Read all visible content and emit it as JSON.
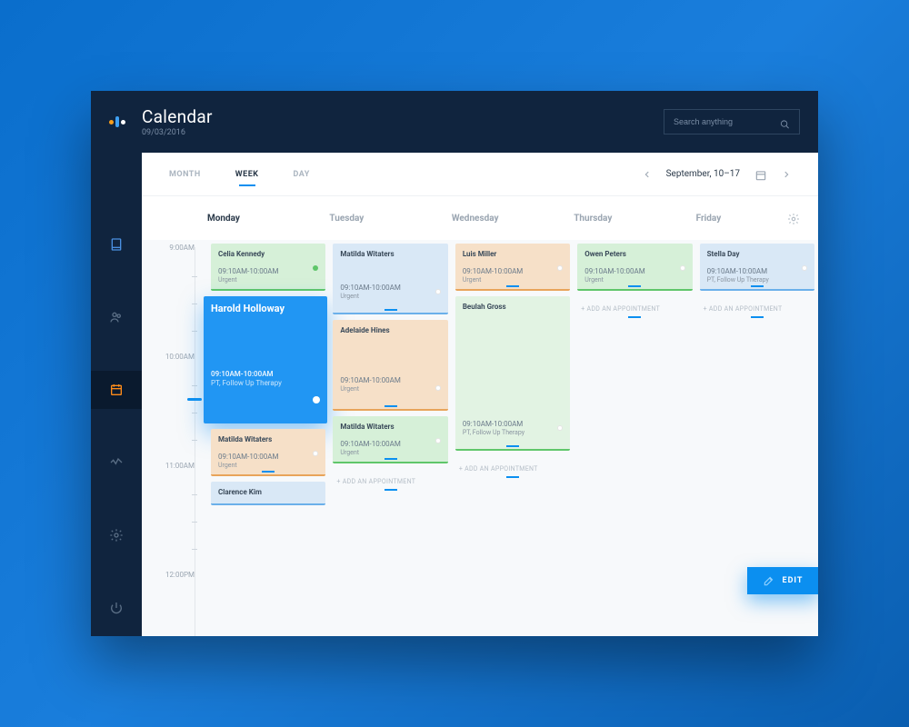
{
  "header": {
    "title": "Calendar",
    "date": "09/03/2016",
    "search_placeholder": "Search anything"
  },
  "toolbar": {
    "tabs": {
      "month": "MONTH",
      "week": "WEEK",
      "day": "DAY"
    },
    "date_range": "September, 10–17"
  },
  "days": [
    "Monday",
    "Tuesday",
    "Wednesday",
    "Thursday",
    "Friday"
  ],
  "times": {
    "t9": "9:00AM",
    "t10": "10:00AM",
    "t11": "11:00AM",
    "t12": "12:00PM"
  },
  "add_label": "+ ADD AN APPOINTMENT",
  "edit_label": "EDIT",
  "appointments": {
    "mon0": {
      "name": "Celia Kennedy",
      "time": "09:10AM-10:00AM",
      "note": "Urgent"
    },
    "mon1": {
      "name": "Harold Holloway",
      "time": "09:10AM-10:00AM",
      "note": "PT, Follow Up Therapy"
    },
    "mon2": {
      "name": "Matilda Witaters",
      "time": "09:10AM-10:00AM",
      "note": "Urgent"
    },
    "mon3": {
      "name": "Clarence Kim"
    },
    "tue0": {
      "name": "Matilda Witaters",
      "time": "09:10AM-10:00AM",
      "note": "Urgent"
    },
    "tue1": {
      "name": "Adelaide Hines",
      "time": "09:10AM-10:00AM",
      "note": "Urgent"
    },
    "tue2": {
      "name": "Matilda Witaters",
      "time": "09:10AM-10:00AM",
      "note": "Urgent"
    },
    "wed0": {
      "name": "Luis Miller",
      "time": "09:10AM-10:00AM",
      "note": "Urgent"
    },
    "wed1": {
      "name": "Beulah Gross",
      "time": "09:10AM-10:00AM",
      "note": "PT, Follow Up Therapy"
    },
    "thu0": {
      "name": "Owen Peters",
      "time": "09:10AM-10:00AM",
      "note": "Urgent"
    },
    "fri0": {
      "name": "Stella Day",
      "time": "09:10AM-10:00AM",
      "note": "PT, Follow Up Therapy"
    }
  }
}
